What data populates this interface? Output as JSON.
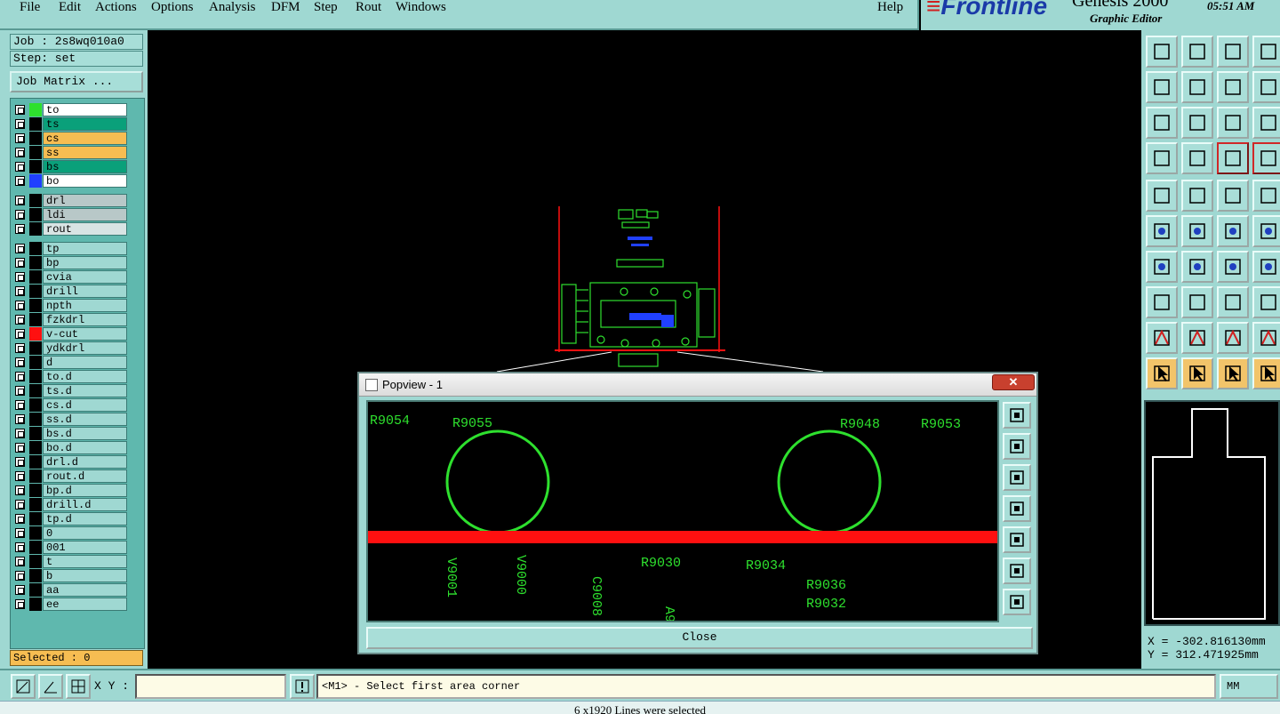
{
  "menu": {
    "items": [
      "File",
      "Edit",
      "Actions",
      "Options",
      "Analysis",
      "DFM",
      "Step",
      "Rout",
      "Windows"
    ],
    "help": "Help"
  },
  "brand": {
    "logo": "Frontline",
    "product": "Genesis 2000",
    "subtitle": "Graphic Editor",
    "clock": "05:51 AM"
  },
  "job": {
    "job_label": "Job : 2s8wq010a0",
    "step_label": "Step: set",
    "matrix_button": "Job Matrix ..."
  },
  "layers": [
    {
      "name": "to",
      "swatch": "#2ee02e",
      "bg": "#ffffff"
    },
    {
      "name": "ts",
      "swatch": "#000000",
      "bg": "#0aa07a"
    },
    {
      "name": "cs",
      "swatch": "#000000",
      "bg": "#f6bd52"
    },
    {
      "name": "ss",
      "swatch": "#000000",
      "bg": "#f6bd52"
    },
    {
      "name": "bs",
      "swatch": "#000000",
      "bg": "#0aa07a"
    },
    {
      "name": "bo",
      "swatch": "#2040ff",
      "bg": "#ffffff"
    },
    {
      "name": "drl",
      "swatch": "#000000",
      "bg": "#b8c8c8",
      "gap_before": true
    },
    {
      "name": "ldi",
      "swatch": "#000000",
      "bg": "#b8c8c8"
    },
    {
      "name": "rout",
      "swatch": "#000000",
      "bg": "#d8e4e4"
    },
    {
      "name": "tp",
      "swatch": "#000000",
      "bg": "#9fd8d2",
      "gap_before": true
    },
    {
      "name": "bp",
      "swatch": "#000000",
      "bg": "#9fd8d2"
    },
    {
      "name": "cvia",
      "swatch": "#000000",
      "bg": "#9fd8d2"
    },
    {
      "name": "drill",
      "swatch": "#000000",
      "bg": "#9fd8d2"
    },
    {
      "name": "npth",
      "swatch": "#000000",
      "bg": "#9fd8d2"
    },
    {
      "name": "fzkdrl",
      "swatch": "#000000",
      "bg": "#9fd8d2"
    },
    {
      "name": "v-cut",
      "swatch": "#ff1010",
      "bg": "#9fd8d2",
      "work": true
    },
    {
      "name": "ydkdrl",
      "swatch": "#000000",
      "bg": "#9fd8d2"
    },
    {
      "name": "d",
      "swatch": "#000000",
      "bg": "#9fd8d2"
    },
    {
      "name": "to.d",
      "swatch": "#000000",
      "bg": "#9fd8d2"
    },
    {
      "name": "ts.d",
      "swatch": "#000000",
      "bg": "#9fd8d2"
    },
    {
      "name": "cs.d",
      "swatch": "#000000",
      "bg": "#9fd8d2"
    },
    {
      "name": "ss.d",
      "swatch": "#000000",
      "bg": "#9fd8d2"
    },
    {
      "name": "bs.d",
      "swatch": "#000000",
      "bg": "#9fd8d2"
    },
    {
      "name": "bo.d",
      "swatch": "#000000",
      "bg": "#9fd8d2"
    },
    {
      "name": "drl.d",
      "swatch": "#000000",
      "bg": "#9fd8d2"
    },
    {
      "name": "rout.d",
      "swatch": "#000000",
      "bg": "#9fd8d2"
    },
    {
      "name": "bp.d",
      "swatch": "#000000",
      "bg": "#9fd8d2"
    },
    {
      "name": "drill.d",
      "swatch": "#000000",
      "bg": "#9fd8d2"
    },
    {
      "name": "tp.d",
      "swatch": "#000000",
      "bg": "#9fd8d2"
    },
    {
      "name": "0",
      "swatch": "#000000",
      "bg": "#9fd8d2"
    },
    {
      "name": "001",
      "swatch": "#000000",
      "bg": "#9fd8d2"
    },
    {
      "name": "t",
      "swatch": "#000000",
      "bg": "#9fd8d2"
    },
    {
      "name": "b",
      "swatch": "#000000",
      "bg": "#9fd8d2"
    },
    {
      "name": "aa",
      "swatch": "#000000",
      "bg": "#9fd8d2"
    },
    {
      "name": "ee",
      "swatch": "#000000",
      "bg": "#9fd8d2"
    }
  ],
  "selected_label": "Selected : 0",
  "popview": {
    "title": "Popview - 1",
    "close_label": "Close",
    "labels": {
      "r9054": "R9054",
      "r9055": "R9055",
      "r9048": "R9048",
      "r9053": "R9053",
      "r9030": "R9030",
      "r9034": "R9034",
      "r9036": "R9036",
      "r9032": "R9032",
      "v9001": "V9001",
      "v9000": "V9000",
      "c9008": "C9008",
      "a9": "A9"
    }
  },
  "coords": {
    "x": "X = -302.816130mm",
    "y": "Y = 312.471925mm"
  },
  "bottom": {
    "xy_label": "X Y :",
    "xy_value": "",
    "prompt": "<M1> - Select first area corner",
    "units": "MM"
  },
  "status": "6 x1920 Lines were selected",
  "colors": {
    "panel": "#9fd8d2",
    "accent": "#f6bd52",
    "trace": "#2ee02e",
    "vcut": "#ff1010",
    "outline": "#ffffff"
  }
}
